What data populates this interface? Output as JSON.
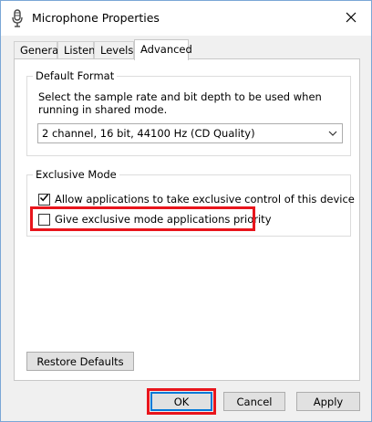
{
  "window": {
    "title": "Microphone Properties"
  },
  "tabs": [
    {
      "label": "General",
      "active": false
    },
    {
      "label": "Listen",
      "active": false
    },
    {
      "label": "Levels",
      "active": false
    },
    {
      "label": "Advanced",
      "active": true
    }
  ],
  "default_format": {
    "legend": "Default Format",
    "description": "Select the sample rate and bit depth to be used when running in shared mode.",
    "selected_option": "2 channel, 16 bit, 44100 Hz (CD Quality)"
  },
  "exclusive_mode": {
    "legend": "Exclusive Mode",
    "allow_exclusive": {
      "label": "Allow applications to take exclusive control of this device",
      "checked": true
    },
    "priority": {
      "label": "Give exclusive mode applications priority",
      "checked": false
    }
  },
  "buttons": {
    "restore_defaults": "Restore Defaults",
    "ok": "OK",
    "cancel": "Cancel",
    "apply": "Apply"
  },
  "colors": {
    "highlight": "#e8151c",
    "window_border": "#7aa7d6",
    "accent": "#0078d7"
  },
  "icons": {
    "title": "microphone-icon",
    "close": "close-icon",
    "dropdown": "chevron-down-icon",
    "check": "checkmark-icon"
  }
}
